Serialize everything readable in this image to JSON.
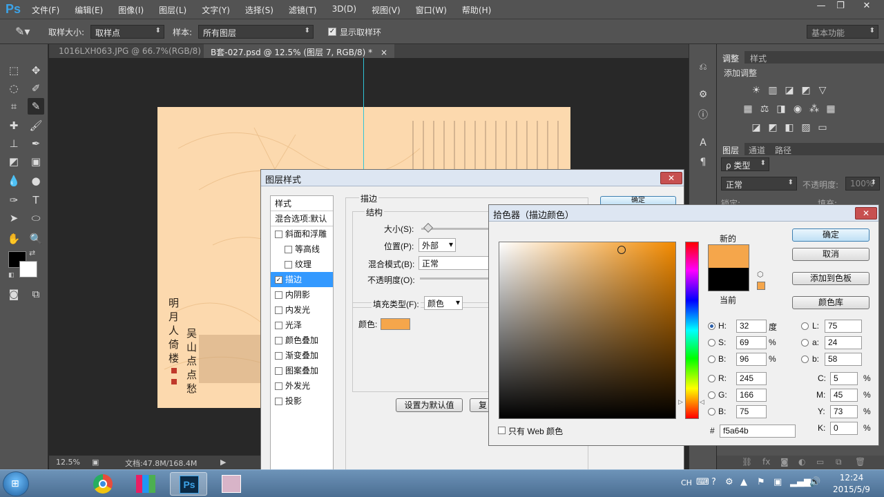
{
  "app": {
    "logo": "Ps",
    "menu": [
      "文件(F)",
      "编辑(E)",
      "图像(I)",
      "图层(L)",
      "文字(Y)",
      "选择(S)",
      "滤镜(T)",
      "3D(D)",
      "视图(V)",
      "窗口(W)",
      "帮助(H)"
    ],
    "window_buttons": [
      "—",
      "❐",
      "✕"
    ]
  },
  "options": {
    "sample_size_label": "取样大小:",
    "sample_size_value": "取样点",
    "sample_label": "样本:",
    "sample_value": "所有图层",
    "show_ring_label": "显示取样环",
    "workspace": "基本功能"
  },
  "tabs": [
    {
      "label": "1016LXH063.JPG @ 66.7%(RGB/8)",
      "close": "×"
    },
    {
      "label": "B套-027.psd @ 12.5% (图层 7, RGB/8) *",
      "close": "×"
    }
  ],
  "canvas": {
    "poem_left": "明月人倚楼",
    "poem_right": "吴山点点愁"
  },
  "status": {
    "zoom": "12.5%",
    "doc": "文档:47.8M/168.4M"
  },
  "right_panel": {
    "tab_adjust": "调整",
    "tab_styles": "样式",
    "add_adjust": "添加调整",
    "layer_tabs": [
      "图层",
      "通道",
      "路径"
    ],
    "filter_kind": "ρ 类型",
    "blend": "正常",
    "opacity_label": "不透明度:",
    "opacity_value": "100%",
    "lock_label": "锁定:",
    "fill_label": "填充:"
  },
  "layer_style": {
    "title": "图层样式",
    "list_header": "样式",
    "blend_default": "混合选项:默认",
    "items": [
      {
        "label": "斜面和浮雕",
        "checked": false,
        "indent": false
      },
      {
        "label": "等高线",
        "checked": false,
        "indent": true
      },
      {
        "label": "纹理",
        "checked": false,
        "indent": true
      },
      {
        "label": "描边",
        "checked": true,
        "indent": false,
        "selected": true
      },
      {
        "label": "内阴影",
        "checked": false,
        "indent": false
      },
      {
        "label": "内发光",
        "checked": false,
        "indent": false
      },
      {
        "label": "光泽",
        "checked": false,
        "indent": false
      },
      {
        "label": "颜色叠加",
        "checked": false,
        "indent": false
      },
      {
        "label": "渐变叠加",
        "checked": false,
        "indent": false
      },
      {
        "label": "图案叠加",
        "checked": false,
        "indent": false
      },
      {
        "label": "外发光",
        "checked": false,
        "indent": false
      },
      {
        "label": "投影",
        "checked": false,
        "indent": false
      }
    ],
    "section": "描边",
    "structure": "结构",
    "size_label": "大小(S):",
    "position_label": "位置(P):",
    "position_value": "外部",
    "blend_label": "混合模式(B):",
    "blend_value": "正常",
    "opacity_label": "不透明度(O):",
    "fill_type_label": "填充类型(F):",
    "fill_type_value": "颜色",
    "color_label": "颜色:",
    "stroke_color": "#f5a64b",
    "btn_default": "设置为默认值",
    "btn_reset": "复",
    "btn_ok": "确定"
  },
  "color_picker": {
    "title": "拾色器（描边颜色）",
    "new_label": "新的",
    "current_label": "当前",
    "new_color": "#f5a64b",
    "current_color": "#000000",
    "btn_ok": "确定",
    "btn_cancel": "取消",
    "btn_add_swatch": "添加到色板",
    "btn_library": "颜色库",
    "h_label": "H:",
    "h_value": "32",
    "h_unit": "度",
    "s_label": "S:",
    "s_value": "69",
    "s_unit": "%",
    "b_label": "B:",
    "b_value": "96",
    "b_unit": "%",
    "r_label": "R:",
    "r_value": "245",
    "g_label": "G:",
    "g_value": "166",
    "bb_label": "B:",
    "bb_value": "75",
    "l_label": "L:",
    "l_value": "75",
    "a_label": "a:",
    "a_value": "24",
    "lb_label": "b:",
    "lb_value": "58",
    "c_label": "C:",
    "c_value": "5",
    "c_unit": "%",
    "m_label": "M:",
    "m_value": "45",
    "m_unit": "%",
    "y_label": "Y:",
    "y_value": "73",
    "y_unit": "%",
    "k_label": "K:",
    "k_value": "0",
    "k_unit": "%",
    "hex_label": "#",
    "hex_value": "f5a64b",
    "web_only_label": "只有 Web 颜色"
  },
  "taskbar": {
    "ime": "CH",
    "time": "12:24",
    "date": "2015/5/9"
  }
}
